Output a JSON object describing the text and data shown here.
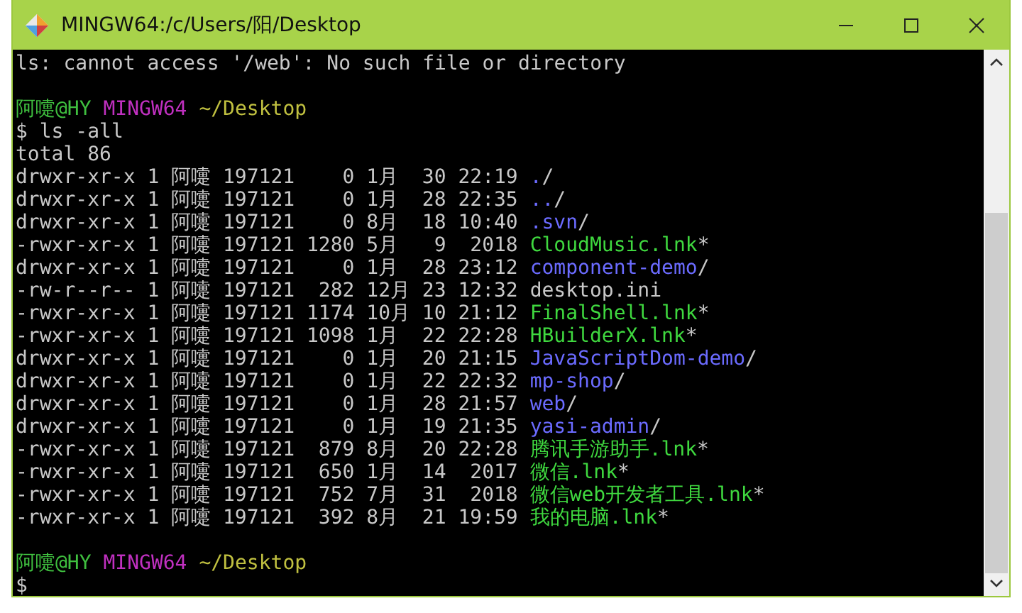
{
  "window": {
    "title": "MINGW64:/c/Users/阳/Desktop"
  },
  "terminal": {
    "lines": [
      {
        "kind": "output",
        "text": "ls: cannot access '/web': No such file or directory"
      },
      {
        "kind": "blank"
      },
      {
        "kind": "prompt",
        "user": "阿嚏@HY",
        "system": "MINGW64",
        "path": "~/Desktop"
      },
      {
        "kind": "command",
        "symbol": "$",
        "text": "ls -all"
      },
      {
        "kind": "output",
        "text": "total 86"
      },
      {
        "kind": "entry",
        "meta": "drwxr-xr-x 1 阿嚏 197121    0 1月  30 22:19",
        "file": {
          "kind": "dir",
          "name": ".",
          "suffix": "/"
        }
      },
      {
        "kind": "entry",
        "meta": "drwxr-xr-x 1 阿嚏 197121    0 1月  28 22:35",
        "file": {
          "kind": "dir",
          "name": "..",
          "suffix": "/"
        }
      },
      {
        "kind": "entry",
        "meta": "drwxr-xr-x 1 阿嚏 197121    0 8月  18 10:40",
        "file": {
          "kind": "dir",
          "name": ".svn",
          "suffix": "/"
        }
      },
      {
        "kind": "entry",
        "meta": "-rwxr-xr-x 1 阿嚏 197121 1280 5月   9  2018",
        "file": {
          "kind": "exec",
          "name": "CloudMusic.lnk",
          "suffix": "*"
        }
      },
      {
        "kind": "entry",
        "meta": "drwxr-xr-x 1 阿嚏 197121    0 1月  28 23:12",
        "file": {
          "kind": "dir",
          "name": "component-demo",
          "suffix": "/"
        }
      },
      {
        "kind": "entry",
        "meta": "-rw-r--r-- 1 阿嚏 197121  282 12月 23 12:32",
        "file": {
          "kind": "plain",
          "name": "desktop.ini"
        }
      },
      {
        "kind": "entry",
        "meta": "-rwxr-xr-x 1 阿嚏 197121 1174 10月 10 21:12",
        "file": {
          "kind": "exec",
          "name": "FinalShell.lnk",
          "suffix": "*"
        }
      },
      {
        "kind": "entry",
        "meta": "-rwxr-xr-x 1 阿嚏 197121 1098 1月  22 22:28",
        "file": {
          "kind": "exec",
          "name": "HBuilderX.lnk",
          "suffix": "*"
        }
      },
      {
        "kind": "entry",
        "meta": "drwxr-xr-x 1 阿嚏 197121    0 1月  20 21:15",
        "file": {
          "kind": "dir",
          "name": "JavaScriptDom-demo",
          "suffix": "/"
        }
      },
      {
        "kind": "entry",
        "meta": "drwxr-xr-x 1 阿嚏 197121    0 1月  22 22:32",
        "file": {
          "kind": "dir",
          "name": "mp-shop",
          "suffix": "/"
        }
      },
      {
        "kind": "entry",
        "meta": "drwxr-xr-x 1 阿嚏 197121    0 1月  28 21:57",
        "file": {
          "kind": "dir",
          "name": "web",
          "suffix": "/"
        }
      },
      {
        "kind": "entry",
        "meta": "drwxr-xr-x 1 阿嚏 197121    0 1月  19 21:35",
        "file": {
          "kind": "dir",
          "name": "yasi-admin",
          "suffix": "/"
        }
      },
      {
        "kind": "entry",
        "meta": "-rwxr-xr-x 1 阿嚏 197121  879 8月  20 22:28",
        "file": {
          "kind": "exec",
          "name": "腾讯手游助手.lnk",
          "suffix": "*"
        }
      },
      {
        "kind": "entry",
        "meta": "-rwxr-xr-x 1 阿嚏 197121  650 1月  14  2017",
        "file": {
          "kind": "exec",
          "name": "微信.lnk",
          "suffix": "*"
        }
      },
      {
        "kind": "entry",
        "meta": "-rwxr-xr-x 1 阿嚏 197121  752 7月  31  2018",
        "file": {
          "kind": "exec",
          "name": "微信web开发者工具.lnk",
          "suffix": "*"
        }
      },
      {
        "kind": "entry",
        "meta": "-rwxr-xr-x 1 阿嚏 197121  392 8月  21 19:59",
        "file": {
          "kind": "exec",
          "name": "我的电脑.lnk",
          "suffix": "*"
        }
      },
      {
        "kind": "blank"
      },
      {
        "kind": "prompt",
        "user": "阿嚏@HY",
        "system": "MINGW64",
        "path": "~/Desktop"
      },
      {
        "kind": "command",
        "symbol": "$"
      }
    ]
  }
}
